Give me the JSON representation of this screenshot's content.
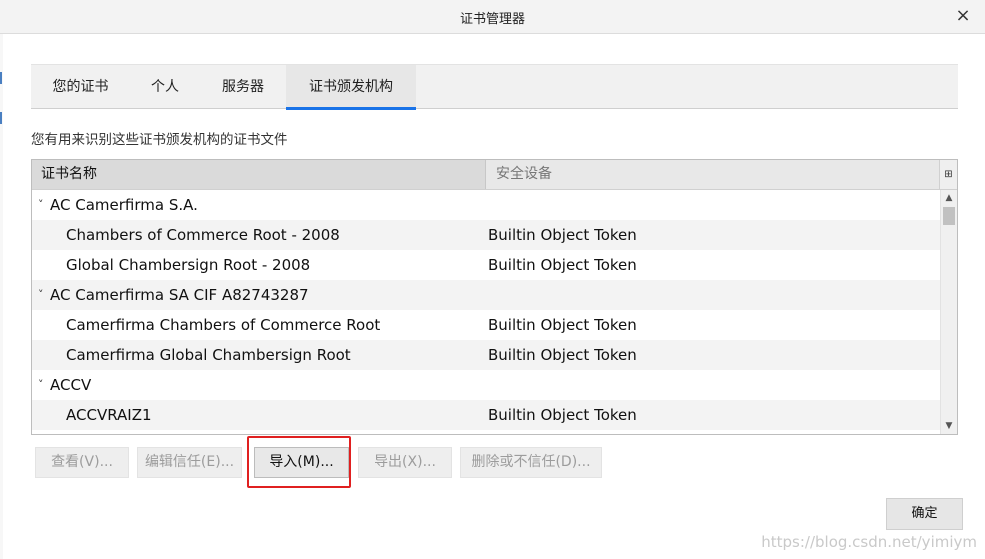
{
  "window": {
    "title": "证书管理器",
    "close_glyph": "×"
  },
  "tabs": [
    {
      "label": "您的证书"
    },
    {
      "label": "个人"
    },
    {
      "label": "服务器"
    },
    {
      "label": "证书颁发机构"
    }
  ],
  "active_tab": "证书颁发机构",
  "description": "您有用来识别这些证书颁发机构的证书文件",
  "tree": {
    "columns": {
      "name": "证书名称",
      "device": "安全设备",
      "picker_glyph": "⊞"
    },
    "rows": [
      {
        "type": "group",
        "twisty": "˅",
        "name": "AC Camerfirma S.A.",
        "device": ""
      },
      {
        "type": "item",
        "name": "Chambers of Commerce Root - 2008",
        "device": "Builtin Object Token"
      },
      {
        "type": "item",
        "name": "Global Chambersign Root - 2008",
        "device": "Builtin Object Token"
      },
      {
        "type": "group",
        "twisty": "˅",
        "name": "AC Camerfirma SA CIF A82743287",
        "device": ""
      },
      {
        "type": "item",
        "name": "Camerfirma Chambers of Commerce Root",
        "device": "Builtin Object Token"
      },
      {
        "type": "item",
        "name": "Camerfirma Global Chambersign Root",
        "device": "Builtin Object Token"
      },
      {
        "type": "group",
        "twisty": "˅",
        "name": "ACCV",
        "device": ""
      },
      {
        "type": "item",
        "name": "ACCVRAIZ1",
        "device": "Builtin Object Token"
      }
    ],
    "scroll": {
      "up_glyph": "▲",
      "down_glyph": "▼"
    }
  },
  "buttons": {
    "view": "查看(V)...",
    "edit_trust": "编辑信任(E)...",
    "import": "导入(M)...",
    "export": "导出(X)...",
    "delete_distrust": "删除或不信任(D)..."
  },
  "ok_button": "确定",
  "watermark": "https://blog.csdn.net/yimiym",
  "colors": {
    "accent": "#1a73e8",
    "highlight": "#e02020"
  }
}
